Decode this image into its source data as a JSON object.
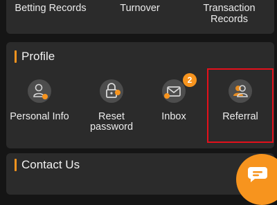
{
  "records": {
    "items": [
      {
        "label": "Betting Records"
      },
      {
        "label": "Turnover"
      },
      {
        "label_lines": [
          "Transaction",
          "Records"
        ]
      }
    ]
  },
  "profile": {
    "title": "Profile",
    "items": [
      {
        "label_lines": [
          "Personal Info"
        ],
        "icon": "personal-info-icon"
      },
      {
        "label_lines": [
          "Reset",
          "password"
        ],
        "icon": "lock-icon"
      },
      {
        "label_lines": [
          "Inbox"
        ],
        "icon": "mail-icon",
        "badge": "2"
      },
      {
        "label_lines": [
          "Referral"
        ],
        "icon": "referral-icon"
      }
    ]
  },
  "contact": {
    "title": "Contact Us"
  },
  "colors": {
    "accent": "#f7941e",
    "card": "#2b2b2b",
    "background": "#151515",
    "highlight": "#e5101b"
  },
  "chat": {
    "icon": "chat-bubble-icon"
  }
}
